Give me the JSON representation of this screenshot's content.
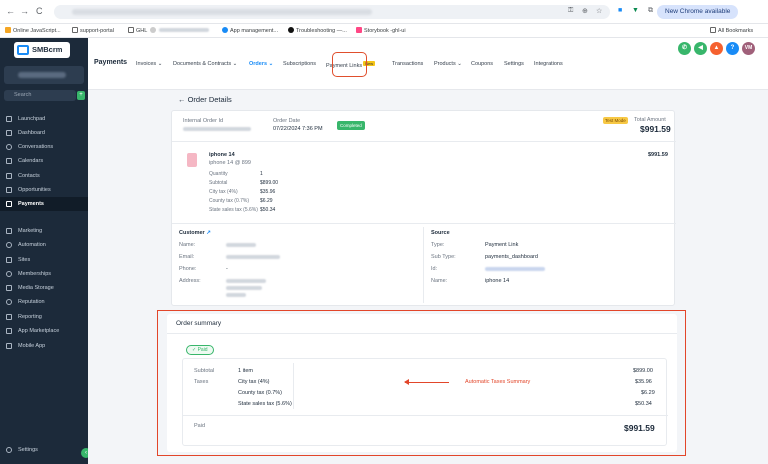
{
  "browser": {
    "nav_back": "←",
    "nav_forward": "→",
    "nav_reload": "C",
    "new_chrome": "New Chrome available",
    "all_bookmarks": "All Bookmarks",
    "bookmarks": [
      "Online JavaScript...",
      "support-portal",
      "GHL",
      "App management...",
      "Troubleshooting —...",
      "Storybook -ghl-ui"
    ]
  },
  "sidebar": {
    "logo": "SMBcrm",
    "search_placeholder": "Search",
    "search_shortcut": "ctrl K",
    "items": [
      {
        "label": "Launchpad",
        "icon": "rocket-icon"
      },
      {
        "label": "Dashboard",
        "icon": "dashboard-icon"
      },
      {
        "label": "Conversations",
        "icon": "chat-icon"
      },
      {
        "label": "Calendars",
        "icon": "calendar-icon"
      },
      {
        "label": "Contacts",
        "icon": "contacts-icon"
      },
      {
        "label": "Opportunities",
        "icon": "opportunities-icon"
      },
      {
        "label": "Payments",
        "icon": "payments-icon"
      },
      {
        "label": "Marketing",
        "icon": "marketing-icon"
      },
      {
        "label": "Automation",
        "icon": "automation-icon"
      },
      {
        "label": "Sites",
        "icon": "sites-icon"
      },
      {
        "label": "Memberships",
        "icon": "memberships-icon"
      },
      {
        "label": "Media Storage",
        "icon": "media-icon"
      },
      {
        "label": "Reputation",
        "icon": "star-icon"
      },
      {
        "label": "Reporting",
        "icon": "reporting-icon"
      },
      {
        "label": "App Marketplace",
        "icon": "marketplace-icon"
      },
      {
        "label": "Mobile App",
        "icon": "mobile-icon"
      }
    ],
    "settings": "Settings"
  },
  "topbar": {
    "title": "Payments",
    "tabs": [
      "Invoices",
      "Documents & Contracts",
      "Orders",
      "Subscriptions",
      "Payment Links",
      "Transactions",
      "Products",
      "Coupons",
      "Settings",
      "Integrations"
    ],
    "new_badge": "New",
    "avatar_initials": "VM"
  },
  "order": {
    "back_title": "← Order Details",
    "internal_id_label": "Internal Order Id",
    "order_date_label": "Order Date",
    "order_date": "07/22/2024 7:36 PM",
    "status": "Completed",
    "test_mode": "Test Mode",
    "total_label": "Total Amount",
    "total": "$991.59",
    "product_name": "iphone 14",
    "product_sub": "iphone 14 @ 899",
    "product_total": "$991.59",
    "lines": [
      {
        "label": "Quantity",
        "value": "1"
      },
      {
        "label": "Subtotal",
        "value": "$899.00"
      },
      {
        "label": "City tax (4%)",
        "value": "$35.96"
      },
      {
        "label": "County tax (0.7%)",
        "value": "$6.29"
      },
      {
        "label": "State sales tax (5.6%)",
        "value": "$50.34"
      }
    ]
  },
  "customer": {
    "heading": "Customer",
    "labels": [
      "Name:",
      "Email:",
      "Phone:",
      "Address:"
    ],
    "phone": "-"
  },
  "source": {
    "heading": "Source",
    "labels": [
      "Type:",
      "Sub Type:",
      "Id:",
      "Name:"
    ],
    "type": "Payment Link",
    "sub_type": "payments_dashboard",
    "name": "iphone 14"
  },
  "summary": {
    "heading": "Order summary",
    "paid_pill": "✓ Paid",
    "subtotal_label": "Subtotal",
    "subtotal_items": "1 item",
    "subtotal_value": "$899.00",
    "taxes_label": "Taxes",
    "taxes": [
      {
        "name": "City tax (4%)",
        "value": "$35.96"
      },
      {
        "name": "County tax (0.7%)",
        "value": "$6.29"
      },
      {
        "name": "State sales tax (5.6%)",
        "value": "$50.34"
      }
    ],
    "paid_label": "Paid",
    "paid_value": "$991.59",
    "annotation": "Automatic Taxes Summary"
  },
  "colors": {
    "accent": "#188bf6",
    "sidebar_bg": "#1c2a3a",
    "success": "#38b66b",
    "annotation": "#e2462a"
  }
}
